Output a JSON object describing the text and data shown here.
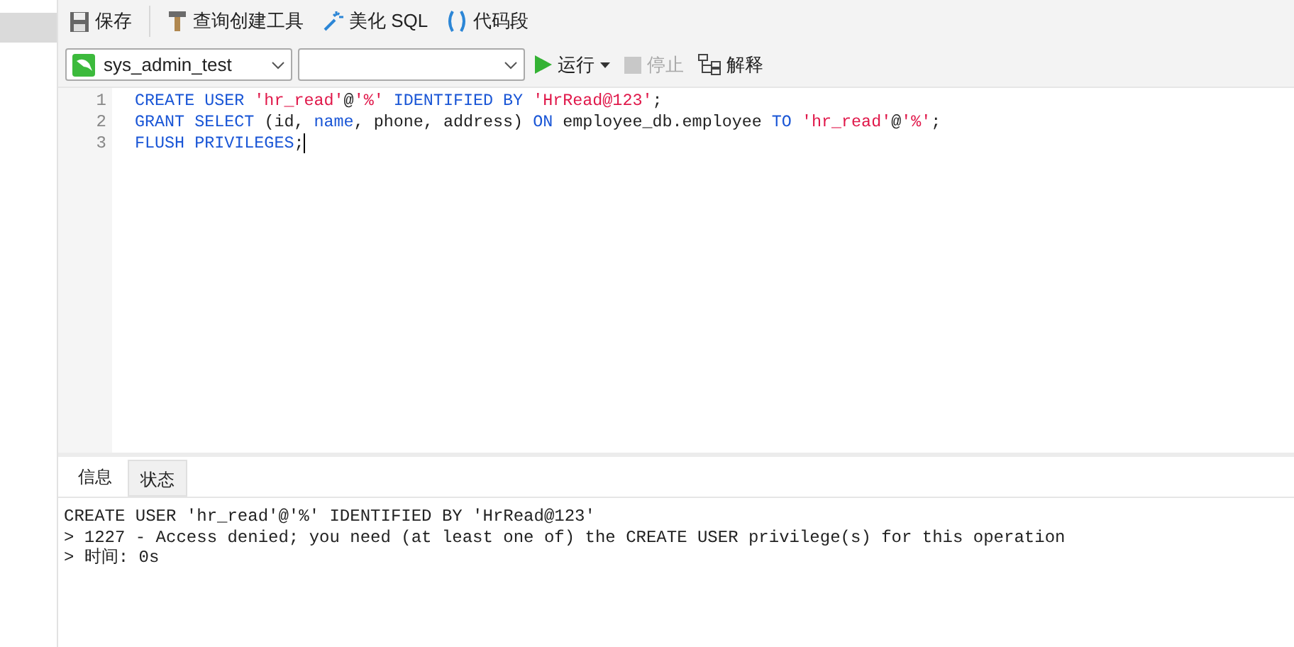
{
  "toolbar": {
    "buttons": [
      {
        "kind": "save",
        "label": "保存"
      },
      {
        "kind": "query-builder",
        "label": "查询创建工具"
      },
      {
        "kind": "beautify",
        "label": "美化 SQL"
      },
      {
        "kind": "snippet",
        "label": "代码段"
      }
    ]
  },
  "run_bar": {
    "connection": "sys_admin_test",
    "run": {
      "label": "运行",
      "disabled": false
    },
    "stop": {
      "label": "停止",
      "disabled": true
    },
    "explain": {
      "label": "解释",
      "disabled": false
    }
  },
  "editor": {
    "lines": [
      {
        "number": "1",
        "tokens": [
          {
            "kind": "keyword",
            "text": "CREATE USER "
          },
          {
            "kind": "string",
            "text": "'hr_read'"
          },
          {
            "kind": "plain",
            "text": "@"
          },
          {
            "kind": "string",
            "text": "'%'"
          },
          {
            "kind": "keyword",
            "text": " IDENTIFIED BY "
          },
          {
            "kind": "string",
            "text": "'HrRead@123'"
          },
          {
            "kind": "plain",
            "text": ";"
          }
        ]
      },
      {
        "number": "2",
        "tokens": [
          {
            "kind": "keyword",
            "text": "GRANT SELECT "
          },
          {
            "kind": "plain",
            "text": "(id, "
          },
          {
            "kind": "keyword",
            "text": "name"
          },
          {
            "kind": "plain",
            "text": ", phone, address) "
          },
          {
            "kind": "keyword",
            "text": "ON"
          },
          {
            "kind": "plain",
            "text": " employee_db.employee "
          },
          {
            "kind": "keyword",
            "text": "TO "
          },
          {
            "kind": "string",
            "text": "'hr_read'"
          },
          {
            "kind": "plain",
            "text": "@"
          },
          {
            "kind": "string",
            "text": "'%'"
          },
          {
            "kind": "plain",
            "text": ";"
          }
        ]
      },
      {
        "number": "3",
        "tokens": [
          {
            "kind": "keyword",
            "text": "FLUSH PRIVILEGES"
          },
          {
            "kind": "plain",
            "text": ";"
          }
        ],
        "cursor": true
      }
    ]
  },
  "result_panel": {
    "tabs": [
      {
        "label": "信息",
        "selected": true
      },
      {
        "label": "状态",
        "selected": false
      }
    ],
    "messages": [
      "CREATE USER 'hr_read'@'%' IDENTIFIED BY 'HrRead@123'",
      "> 1227 - Access denied; you need (at least one of) the CREATE USER privilege(s) for this operation",
      "> 时间: 0s"
    ]
  }
}
